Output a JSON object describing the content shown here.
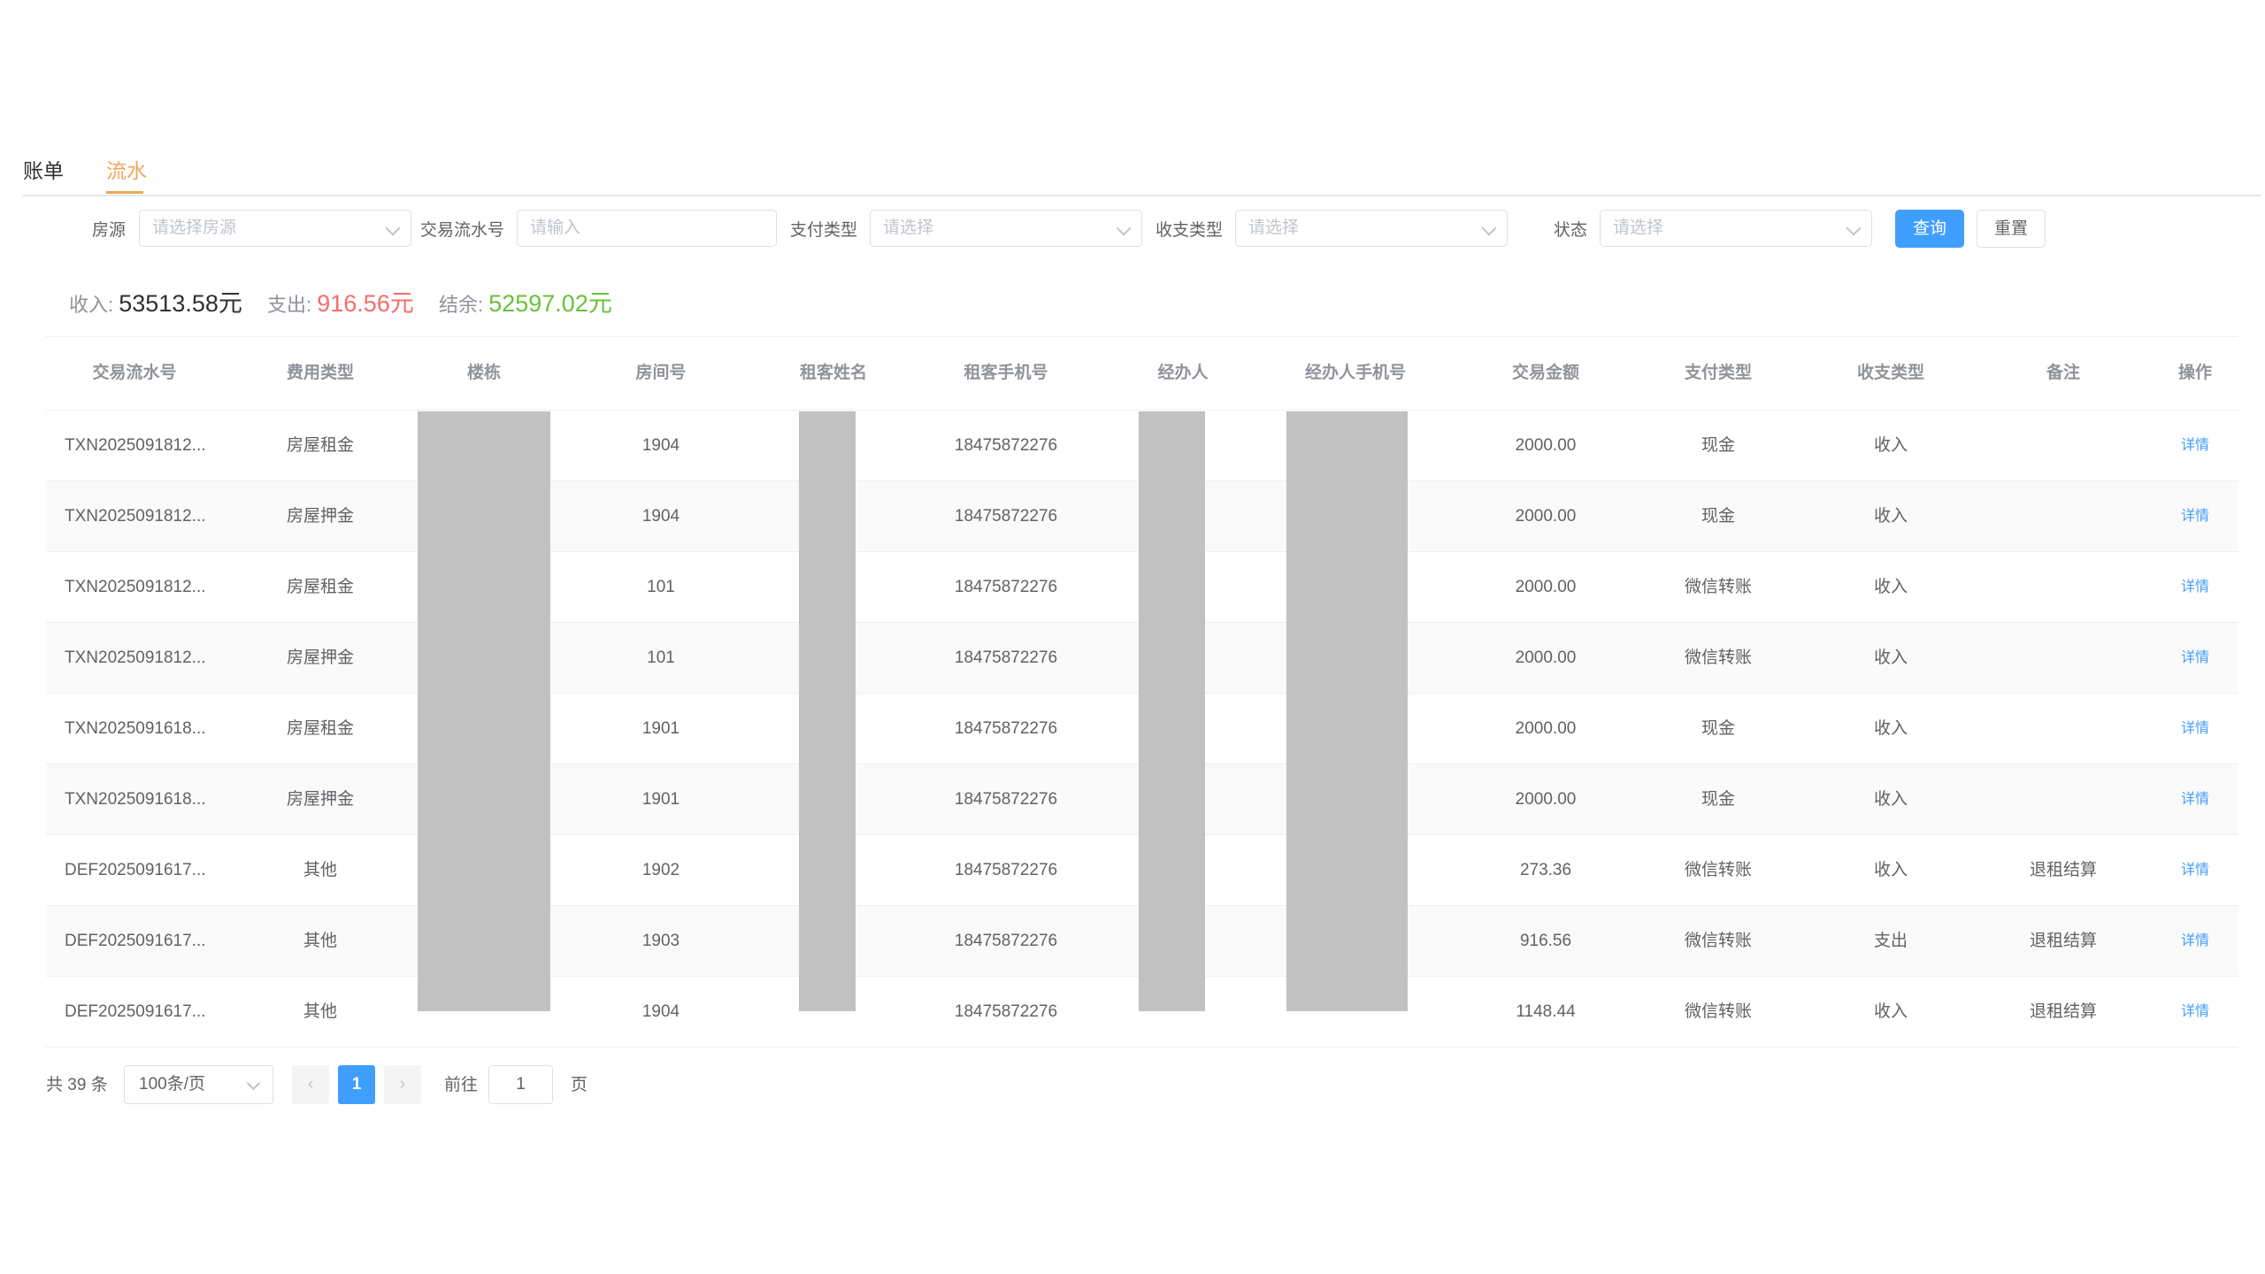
{
  "tabs": [
    {
      "label": "账单",
      "active": false
    },
    {
      "label": "流水",
      "active": true
    }
  ],
  "filters": {
    "house_label": "房源",
    "house_placeholder": "请选择房源",
    "txn_label": "交易流水号",
    "txn_placeholder": "请输入",
    "paytype_label": "支付类型",
    "paytype_placeholder": "请选择",
    "iotype_label": "收支类型",
    "iotype_placeholder": "请选择",
    "status_label": "状态",
    "status_placeholder": "请选择",
    "query_button": "查询",
    "reset_button": "重置"
  },
  "summary": {
    "income_label": "收入:",
    "income_value": "53513.58元",
    "expense_label": "支出:",
    "expense_value": "916.56元",
    "balance_label": "结余:",
    "balance_value": "52597.02元"
  },
  "table": {
    "columns": [
      "交易流水号",
      "费用类型",
      "楼栋",
      "房间号",
      "租客姓名",
      "租客手机号",
      "经办人",
      "经办人手机号",
      "交易金额",
      "支付类型",
      "收支类型",
      "备注",
      "操作"
    ],
    "rows": [
      {
        "txn": "TXN2025091812...",
        "fee_type": "房屋租金",
        "room": "1904",
        "phone": "18475872276",
        "amount": "2000.00",
        "pay_type": "现金",
        "io_type": "收入",
        "note": "",
        "action": "详情"
      },
      {
        "txn": "TXN2025091812...",
        "fee_type": "房屋押金",
        "room": "1904",
        "phone": "18475872276",
        "amount": "2000.00",
        "pay_type": "现金",
        "io_type": "收入",
        "note": "",
        "action": "详情"
      },
      {
        "txn": "TXN2025091812...",
        "fee_type": "房屋租金",
        "room": "101",
        "phone": "18475872276",
        "amount": "2000.00",
        "pay_type": "微信转账",
        "io_type": "收入",
        "note": "",
        "action": "详情"
      },
      {
        "txn": "TXN2025091812...",
        "fee_type": "房屋押金",
        "room": "101",
        "phone": "18475872276",
        "amount": "2000.00",
        "pay_type": "微信转账",
        "io_type": "收入",
        "note": "",
        "action": "详情"
      },
      {
        "txn": "TXN2025091618...",
        "fee_type": "房屋租金",
        "room": "1901",
        "phone": "18475872276",
        "amount": "2000.00",
        "pay_type": "现金",
        "io_type": "收入",
        "note": "",
        "action": "详情"
      },
      {
        "txn": "TXN2025091618...",
        "fee_type": "房屋押金",
        "room": "1901",
        "phone": "18475872276",
        "amount": "2000.00",
        "pay_type": "现金",
        "io_type": "收入",
        "note": "",
        "action": "详情"
      },
      {
        "txn": "DEF2025091617...",
        "fee_type": "其他",
        "room": "1902",
        "phone": "18475872276",
        "amount": "273.36",
        "pay_type": "微信转账",
        "io_type": "收入",
        "note": "退租结算",
        "action": "详情"
      },
      {
        "txn": "DEF2025091617...",
        "fee_type": "其他",
        "room": "1903",
        "phone": "18475872276",
        "amount": "916.56",
        "pay_type": "微信转账",
        "io_type": "支出",
        "note": "退租结算",
        "action": "详情"
      },
      {
        "txn": "DEF2025091617...",
        "fee_type": "其他",
        "room": "1904",
        "phone": "18475872276",
        "amount": "1148.44",
        "pay_type": "微信转账",
        "io_type": "收入",
        "note": "退租结算",
        "action": "详情"
      }
    ]
  },
  "pagination": {
    "total_text": "共 39 条",
    "page_size": "100条/页",
    "current_page": "1",
    "goto_label": "前往",
    "goto_value": "1",
    "page_suffix": "页"
  }
}
